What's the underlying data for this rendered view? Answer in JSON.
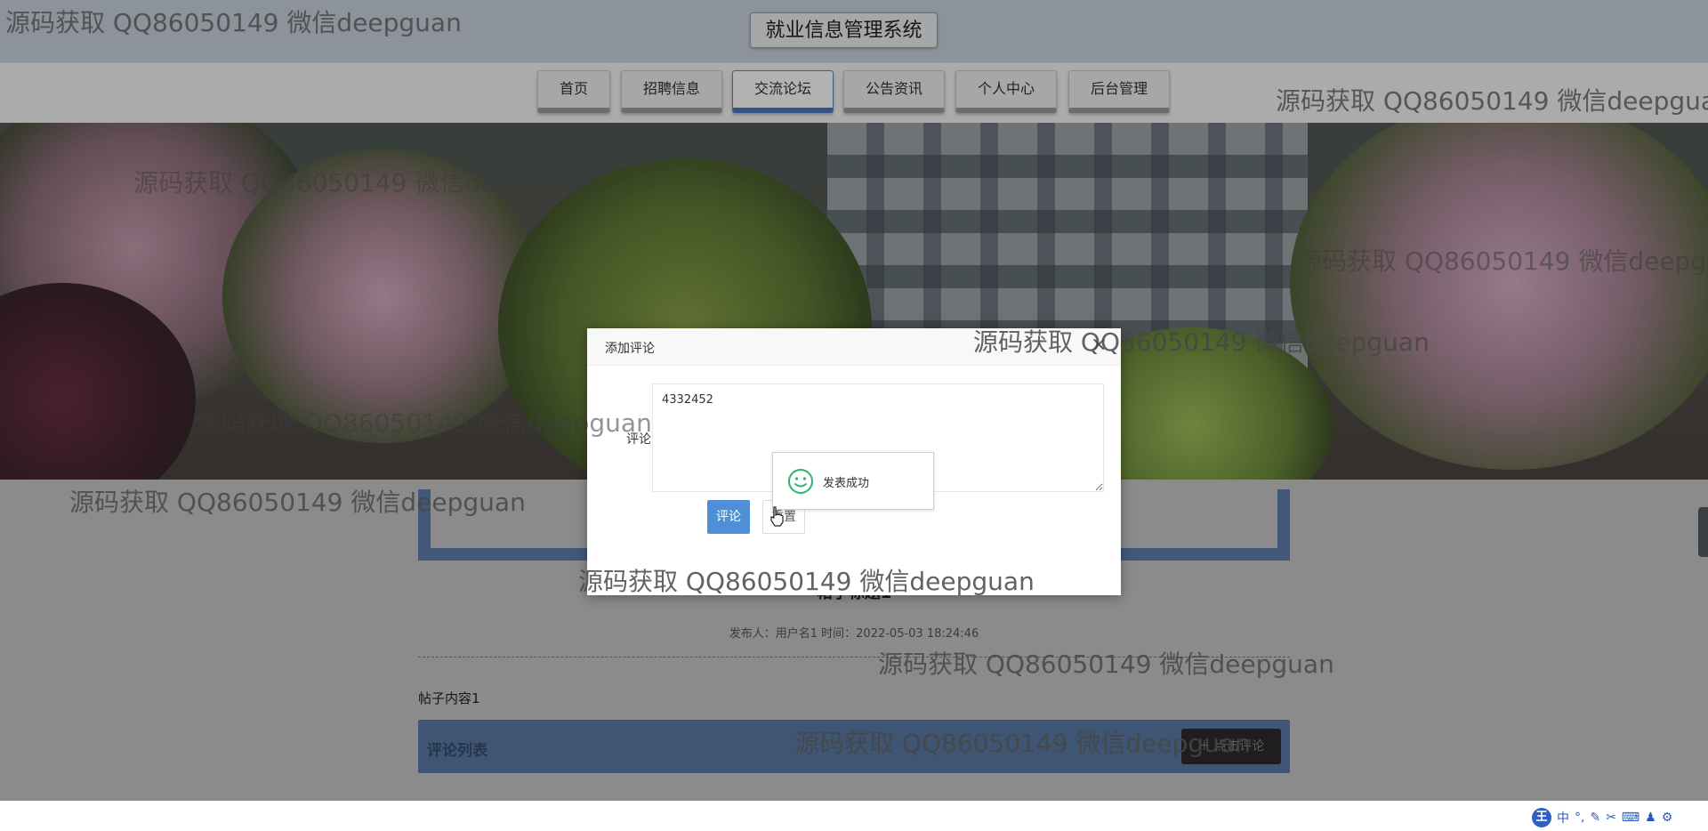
{
  "header": {
    "system_title": "就业信息管理系统"
  },
  "nav": {
    "items": [
      {
        "label": "首页"
      },
      {
        "label": "招聘信息"
      },
      {
        "label": "交流论坛"
      },
      {
        "label": "公告资讯"
      },
      {
        "label": "个人中心"
      },
      {
        "label": "后台管理"
      }
    ],
    "active": "交流论坛"
  },
  "post": {
    "title": "帖子标题1",
    "meta": "发布人：用户名1 时间：2022-05-03 18:24:46",
    "content": "帖子内容1",
    "comment_list_title": "评论列表",
    "add_comment_label": "点击评论"
  },
  "modal": {
    "title": "添加评论",
    "close_symbol": "×",
    "field_label": "评论",
    "comment_value": "4332452",
    "submit_label": "评论",
    "reset_label": "重置"
  },
  "toast": {
    "message": "发表成功"
  },
  "watermark": {
    "text": "源码获取 QQ86050149 微信deepguan"
  },
  "ime": {
    "logo": "王",
    "mode": "中",
    "icons": [
      "punctuation-icon",
      "pen-icon",
      "scissors-icon",
      "keyboard-icon",
      "shirt-icon",
      "settings-icon"
    ]
  },
  "colors": {
    "primary": "#4e8fd6",
    "panel": "#5b7aa6",
    "success": "#2fb36b"
  }
}
